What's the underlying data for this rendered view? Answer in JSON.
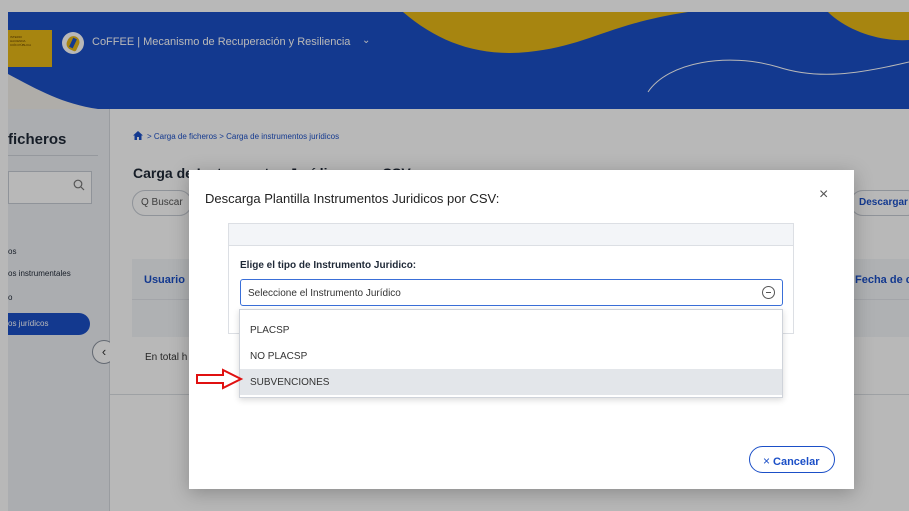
{
  "header": {
    "logo_text": [
      "ISTERIO",
      "HACIENDA",
      "CIÓN PÚBLICA"
    ],
    "app_title": "CoFFEE  |  Mecanismo de Recuperación y Resiliencia",
    "chevron": "⌄"
  },
  "sidebar": {
    "title": "ficheros",
    "search_icon": "search-icon",
    "items": [
      {
        "label": "os"
      },
      {
        "label": "os instrumentales"
      },
      {
        "label": "o"
      }
    ],
    "active_item": "os jurídicos",
    "collapse_symbol": "‹"
  },
  "main": {
    "breadcrumb": "> Carga de ficheros > Carga de instrumentos jurídicos",
    "page_title": "Carga de Instrumentos Jurídicos por CSV",
    "search_placeholder": "Q Buscar",
    "download_label": "Descargar plantilla",
    "table": {
      "columns": [
        "Usuario",
        "Fecha de carga"
      ]
    },
    "total_text": "En total h"
  },
  "modal": {
    "title": "Descarga Plantilla Instrumentos Juridicos por CSV:",
    "close_symbol": "×",
    "field_label": "Elige el tipo de Instrumento Juridico:",
    "select_placeholder": "Seleccione el Instrumento Jurídico",
    "options": [
      "PLACSP",
      "NO PLACSP",
      "SUBVENCIONES"
    ],
    "highlighted_option": "SUBVENCIONES",
    "cancel_label": "Cancelar",
    "cancel_symbol": "×"
  },
  "colors": {
    "brand_blue": "#1b4fc7",
    "logo_yellow": "#e8b917",
    "annotation_red": "#e01010"
  }
}
